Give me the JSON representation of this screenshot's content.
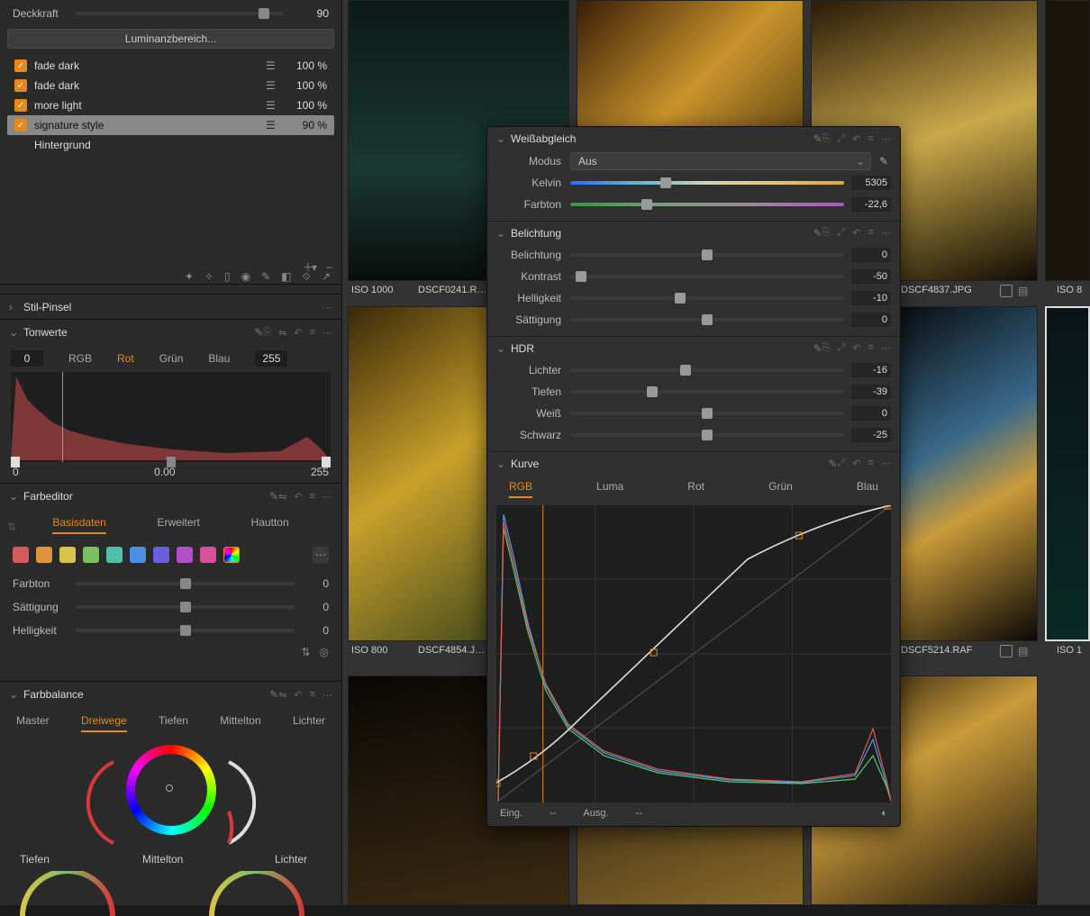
{
  "opacity": {
    "label": "Deckkraft",
    "value": "90",
    "percent": 90
  },
  "lum_button": "Luminanzbereich...",
  "layers": [
    {
      "name": "fade dark",
      "pct": "100 %",
      "selected": false
    },
    {
      "name": "fade dark",
      "pct": "100 %",
      "selected": false
    },
    {
      "name": "more light",
      "pct": "100 %",
      "selected": false
    },
    {
      "name": "signature style",
      "pct": "90 %",
      "selected": true
    }
  ],
  "background_label": "Hintergrund",
  "panels": {
    "stilpinsel": {
      "title": "Stil-Pinsel"
    },
    "tonwerte": {
      "title": "Tonwerte",
      "min": "0",
      "max": "255",
      "channels": [
        "RGB",
        "Rot",
        "Grün",
        "Blau"
      ],
      "active": "Rot",
      "vals": {
        "low": "0",
        "mid": "0.00",
        "high": "255"
      }
    },
    "farbeditor": {
      "title": "Farbeditor",
      "tabs": [
        "Basisdaten",
        "Erweitert",
        "Hautton"
      ],
      "active": "Basisdaten",
      "swatches": [
        "#d85a5a",
        "#e0923c",
        "#d8c34a",
        "#7ac060",
        "#4fc0b0",
        "#4a8fe0",
        "#6a5fe0",
        "#b04fc8",
        "#d84f9a",
        "rainbow"
      ],
      "sliders": [
        {
          "label": "Farbton",
          "value": "0"
        },
        {
          "label": "Sättigung",
          "value": "0"
        },
        {
          "label": "Helligkeit",
          "value": "0"
        }
      ]
    },
    "farbbalance": {
      "title": "Farbbalance",
      "tabs": [
        "Master",
        "Dreiwege",
        "Tiefen",
        "Mittelton",
        "Lichter"
      ],
      "active": "Dreiwege",
      "labels": {
        "tiefen": "Tiefen",
        "mittelton": "Mittelton",
        "lichter": "Lichter"
      }
    }
  },
  "palette": {
    "wb": {
      "title": "Weißabgleich",
      "mode_label": "Modus",
      "mode_value": "Aus",
      "kelvin_label": "Kelvin",
      "kelvin_value": "5305",
      "kelvin_pos": 35,
      "tint_label": "Farbton",
      "tint_value": "-22,6",
      "tint_pos": 28
    },
    "exposure": {
      "title": "Belichtung",
      "rows": [
        {
          "label": "Belichtung",
          "value": "0",
          "pos": 50
        },
        {
          "label": "Kontrast",
          "value": "-50",
          "pos": 4
        },
        {
          "label": "Helligkeit",
          "value": "-10",
          "pos": 40
        },
        {
          "label": "Sättigung",
          "value": "0",
          "pos": 50
        }
      ]
    },
    "hdr": {
      "title": "HDR",
      "rows": [
        {
          "label": "Lichter",
          "value": "-16",
          "pos": 42
        },
        {
          "label": "Tiefen",
          "value": "-39",
          "pos": 30
        },
        {
          "label": "Weiß",
          "value": "0",
          "pos": 50
        },
        {
          "label": "Schwarz",
          "value": "-25",
          "pos": 50
        }
      ]
    },
    "curve": {
      "title": "Kurve",
      "tabs": [
        "RGB",
        "Luma",
        "Rot",
        "Grün",
        "Blau"
      ],
      "active": "RGB",
      "in_label": "Eing.",
      "in_value": "--",
      "out_label": "Ausg.",
      "out_value": "--"
    }
  },
  "thumbs": {
    "r1c1": {
      "iso": "ISO 1000",
      "file": "DSCF0241.R…"
    },
    "r1c3": {
      "file": "DSCF4837.JPG"
    },
    "r1c4": {
      "iso": "ISO 8"
    },
    "r2c1": {
      "iso": "ISO 800",
      "file": "DSCF4854.J…"
    },
    "r2c3": {
      "file": "DSCF5214.RAF"
    },
    "r2c4": {
      "iso": "ISO 1"
    }
  },
  "chart_data": {
    "type": "line",
    "title": "Kurve — RGB",
    "xlabel": "Eing.",
    "ylabel": "Ausg.",
    "xlim": [
      0,
      255
    ],
    "ylim": [
      0,
      255
    ],
    "curve_points": [
      {
        "in": 0,
        "out": 17
      },
      {
        "in": 24,
        "out": 40
      },
      {
        "in": 102,
        "out": 129
      },
      {
        "in": 196,
        "out": 230
      },
      {
        "in": 255,
        "out": 255
      }
    ],
    "histogram_rgb_approx": {
      "x": [
        0,
        8,
        16,
        24,
        32,
        48,
        64,
        96,
        128,
        160,
        192,
        224,
        240,
        248,
        255
      ],
      "red": [
        5,
        240,
        200,
        150,
        100,
        70,
        50,
        35,
        25,
        20,
        18,
        18,
        22,
        55,
        30
      ],
      "green": [
        5,
        230,
        180,
        140,
        95,
        65,
        45,
        32,
        22,
        18,
        16,
        16,
        18,
        40,
        20
      ],
      "blue": [
        5,
        255,
        190,
        130,
        85,
        55,
        38,
        26,
        18,
        14,
        12,
        12,
        14,
        30,
        15
      ]
    },
    "tonwerte_red_histogram": {
      "xlim": [
        0,
        255
      ],
      "x": [
        0,
        6,
        12,
        20,
        30,
        45,
        60,
        80,
        110,
        150,
        200,
        235,
        248,
        255
      ],
      "y": [
        10,
        95,
        70,
        55,
        42,
        34,
        28,
        22,
        17,
        13,
        10,
        12,
        28,
        15
      ]
    }
  }
}
